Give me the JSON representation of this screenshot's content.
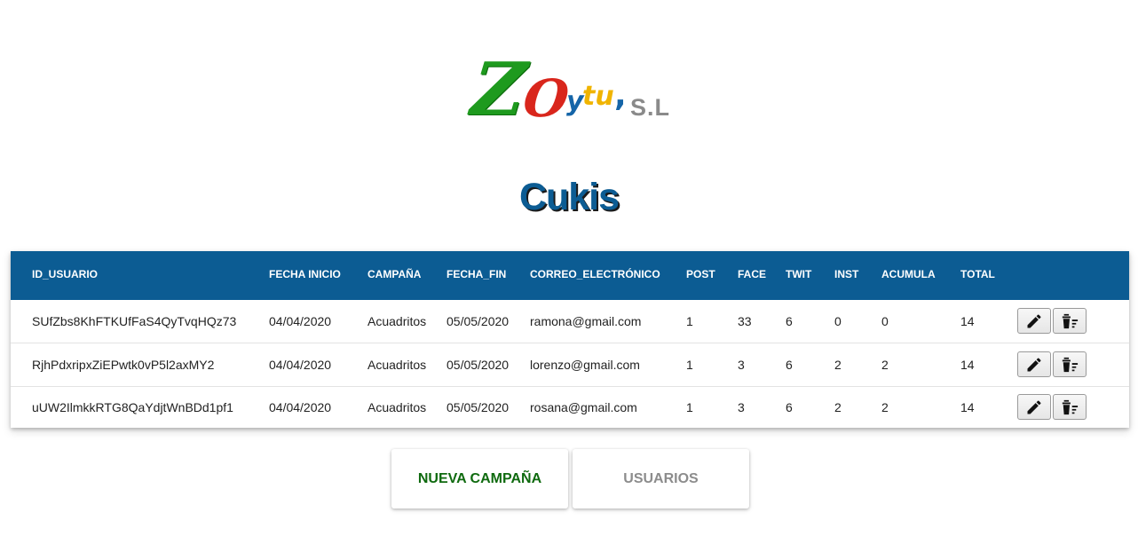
{
  "logo": {
    "z": "Z",
    "o": "O",
    "y": "y",
    "tu": "tu",
    "comma": ",",
    "sl": "S.L"
  },
  "page_title": "Cukis",
  "table": {
    "headers": [
      "ID_USUARIO",
      "FECHA INICIO",
      "CAMPAÑA",
      "FECHA_FIN",
      "CORREO_ELECTRÓNICO",
      "POST",
      "FACE",
      "TWIT",
      "INST",
      "ACUMULA",
      "TOTAL"
    ],
    "rows": [
      [
        "SUfZbs8KhFTKUfFaS4QyTvqHQz73",
        "04/04/2020",
        "Acuadritos",
        "05/05/2020",
        "ramona@gmail.com",
        "1",
        "33",
        "6",
        "0",
        "0",
        "14"
      ],
      [
        "RjhPdxripxZiEPwtk0vP5l2axMY2",
        "04/04/2020",
        "Acuadritos",
        "05/05/2020",
        "lorenzo@gmail.com",
        "1",
        "3",
        "6",
        "2",
        "2",
        "14"
      ],
      [
        "uUW2IlmkkRTG8QaYdjtWnBDd1pf1",
        "04/04/2020",
        "Acuadritos",
        "05/05/2020",
        "rosana@gmail.com",
        "1",
        "3",
        "6",
        "2",
        "2",
        "14"
      ]
    ],
    "row_actions": {
      "edit_icon": "pencil-icon",
      "delete_icon": "trash-sort-icon"
    }
  },
  "buttons": {
    "new_campaign": "NUEVA CAMPAÑA",
    "users": "USUARIOS"
  },
  "colors": {
    "header_bg": "#0c5c93",
    "title": "#0c5c93",
    "new_campaign_text": "#0f6a0f",
    "users_text": "#8c8c8c"
  }
}
